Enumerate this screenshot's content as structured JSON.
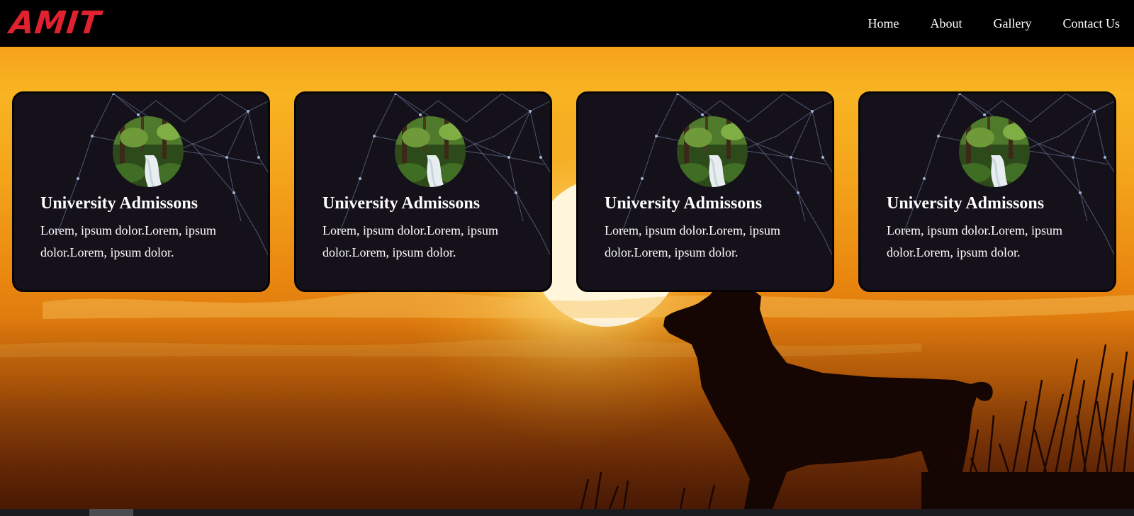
{
  "logo": {
    "text": "AMIT"
  },
  "nav": {
    "items": [
      "Home",
      "About",
      "Gallery",
      "Contact Us"
    ]
  },
  "cards": [
    {
      "title": "University Admissons",
      "text": "Lorem, ipsum dolor.Lorem, ipsum dolor.Lorem, ipsum dolor."
    },
    {
      "title": "University Admissons",
      "text": "Lorem, ipsum dolor.Lorem, ipsum dolor.Lorem, ipsum dolor."
    },
    {
      "title": "University Admissons",
      "text": "Lorem, ipsum dolor.Lorem, ipsum dolor.Lorem, ipsum dolor."
    },
    {
      "title": "University Admissons",
      "text": "Lorem, ipsum dolor.Lorem, ipsum dolor.Lorem, ipsum dolor."
    }
  ],
  "colors": {
    "navbar": "#000000",
    "logo": "#e0212f",
    "card_bg": "#15111a",
    "sky_top": "#f8b422",
    "sky_bottom": "#7a2f07"
  },
  "icons": {
    "card_image": "forest-waterfall-image",
    "card_background": "network-lines-pattern",
    "hero_background": "sunset-wolf-silhouette-image"
  },
  "taskbar": {
    "text": ""
  }
}
